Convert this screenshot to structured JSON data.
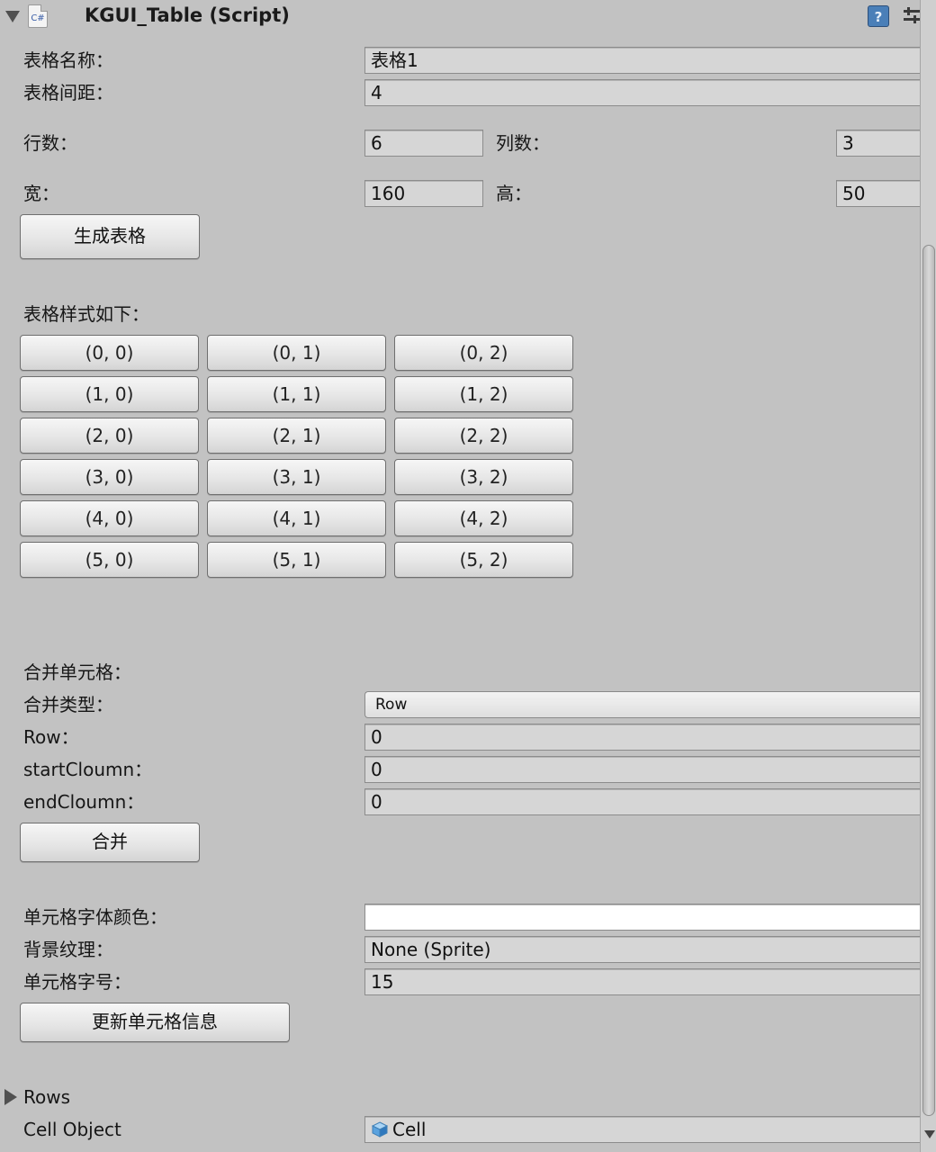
{
  "header": {
    "title": "KGUI_Table (Script)",
    "script_icon_text": "C#",
    "help_icon": "help-icon",
    "settings_icon": "settings-icon"
  },
  "table_name": {
    "label": "表格名称：",
    "value": "表格1"
  },
  "table_spacing": {
    "label": "表格间距：",
    "value": "4"
  },
  "rows": {
    "label": "行数：",
    "value": "6"
  },
  "cols": {
    "label": "列数：",
    "value": "3"
  },
  "width": {
    "label": "宽：",
    "value": "160"
  },
  "height": {
    "label": "高：",
    "value": "50"
  },
  "generate_button": "生成表格",
  "style_label": "表格样式如下：",
  "grid": [
    [
      "(0, 0)",
      "(0, 1)",
      "(0, 2)"
    ],
    [
      "(1, 0)",
      "(1, 1)",
      "(1, 2)"
    ],
    [
      "(2, 0)",
      "(2, 1)",
      "(2, 2)"
    ],
    [
      "(3, 0)",
      "(3, 1)",
      "(3, 2)"
    ],
    [
      "(4, 0)",
      "(4, 1)",
      "(4, 2)"
    ],
    [
      "(5, 0)",
      "(5, 1)",
      "(5, 2)"
    ]
  ],
  "merge": {
    "section_label": "合并单元格：",
    "type_label": "合并类型：",
    "type_value": "Row",
    "row_label": "Row：",
    "row_value": "0",
    "start_label": "startCloumn：",
    "start_value": "0",
    "end_label": "endCloumn：",
    "end_value": "0",
    "button": "合并"
  },
  "cell_info": {
    "font_color_label": "单元格字体颜色：",
    "font_color_value": "#ffffff",
    "bg_label": "背景纹理：",
    "bg_value": "None (Sprite)",
    "font_size_label": "单元格字号：",
    "font_size_value": "15",
    "button": "更新单元格信息"
  },
  "rows_foldout": "Rows",
  "cell_object": {
    "label": "Cell Object",
    "value": "Cell",
    "icon": "cube-icon"
  }
}
